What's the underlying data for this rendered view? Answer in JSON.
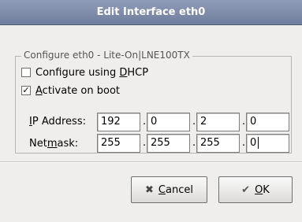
{
  "window": {
    "title": "Edit Interface eth0"
  },
  "frame": {
    "label": "Configure eth0 - Lite-On|LNE100TX"
  },
  "options": {
    "dhcp": {
      "pre": "Configure using ",
      "mnemonic": "D",
      "post": "HCP",
      "checked": false
    },
    "boot": {
      "pre": "",
      "mnemonic": "A",
      "post": "ctivate on boot",
      "checked": true,
      "mark": "✓"
    }
  },
  "ip": {
    "label_pre": "",
    "label_mnemonic": "I",
    "label_post": "P Address:",
    "octets": [
      "192",
      "0",
      "2",
      "0"
    ]
  },
  "netmask": {
    "label_pre": "Net",
    "label_mnemonic": "m",
    "label_post": "ask:",
    "octets": [
      "255",
      "255",
      "255",
      "0"
    ]
  },
  "dot": ".",
  "buttons": {
    "cancel": {
      "icon": "cancel-icon",
      "glyph": "✖",
      "mnemonic": "C",
      "rest": "ancel"
    },
    "ok": {
      "icon": "ok-icon",
      "glyph": "✔",
      "mnemonic": "O",
      "rest": "K"
    }
  }
}
